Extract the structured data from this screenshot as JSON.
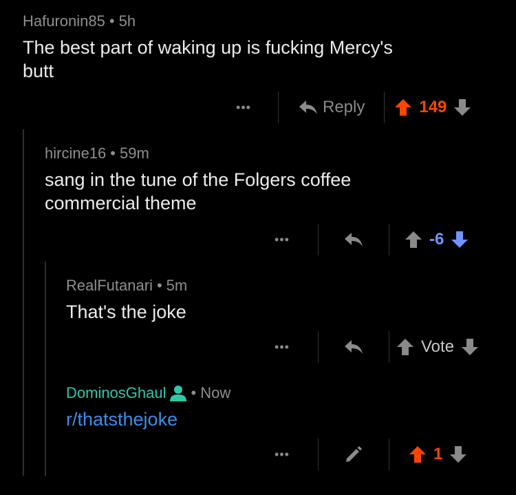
{
  "comments": [
    {
      "author": "Hafuronin85",
      "sep": "•",
      "time": "5h",
      "body": "The best part of waking up is fucking Mercy's butt",
      "reply_label": "Reply",
      "score": "149",
      "score_color": "#ff4500"
    },
    {
      "author": "hircine16",
      "sep": "•",
      "time": "59m",
      "body": "sang in the tune of the Folgers coffee commercial theme",
      "score": "-6",
      "score_color": "#7193ff"
    },
    {
      "author": "RealFutanari",
      "sep": "•",
      "time": "5m",
      "body": "That's the joke",
      "score": "Vote",
      "score_color": "#c8c8c8"
    },
    {
      "author": "DominosGhaul",
      "sep": "•",
      "time": "Now",
      "body": "r/thatsthejoke",
      "score": "1",
      "score_color": "#ff4500"
    }
  ],
  "more_label": "•••",
  "colors": {
    "upvote_active": "#ff4500",
    "downvote_active": "#7193ff",
    "op": "#2fc8a8",
    "link": "#3d8ee6"
  }
}
